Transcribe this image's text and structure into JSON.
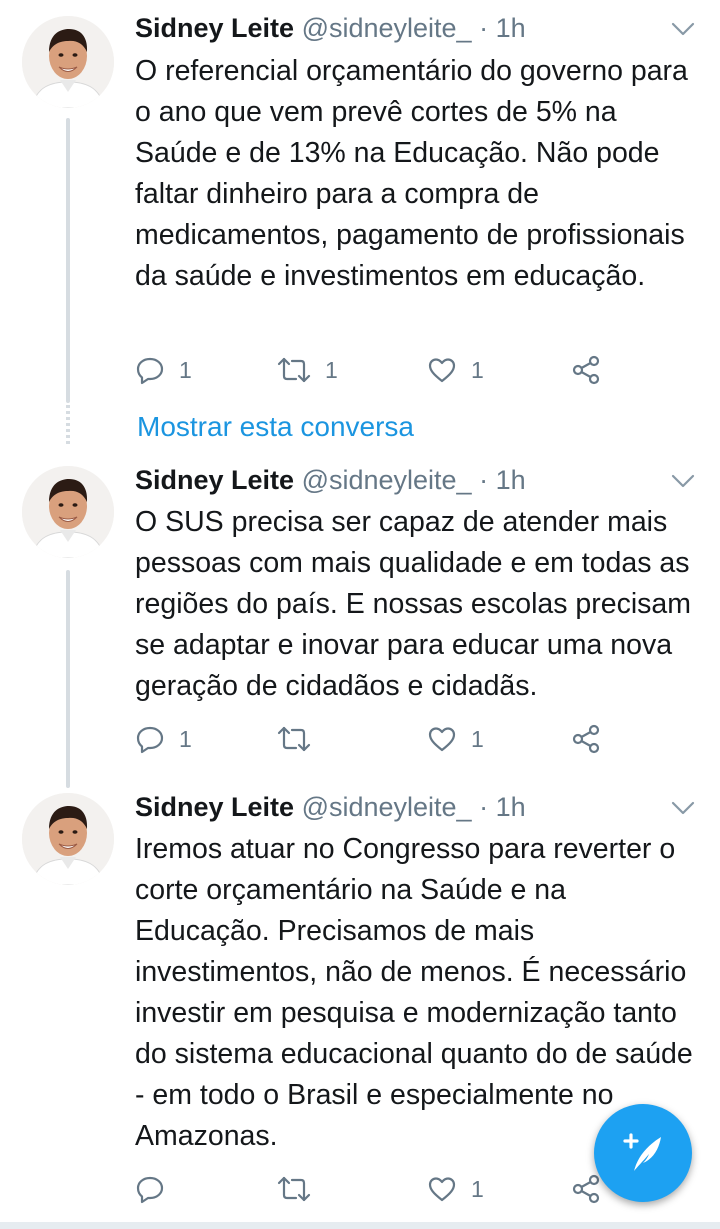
{
  "colors": {
    "accent": "#1da1f2",
    "link": "#1b95e0",
    "muted": "#657786",
    "text": "#14171a",
    "thread_line": "#d6dce1"
  },
  "show_conversation": "Mostrar esta conversa",
  "tweets": [
    {
      "name": "Sidney Leite",
      "handle": "@sidneyleite_",
      "separator": "·",
      "time": "1h",
      "text": "O referencial orçamentário do governo para o ano que vem prevê cortes de 5% na Saúde e de 13% na Educação. Não pode faltar dinheiro para a compra de medicamentos, pagamento de profissionais da saúde e investimentos em educação.",
      "replies": "1",
      "retweets": "1",
      "likes": "1"
    },
    {
      "name": "Sidney Leite",
      "handle": "@sidneyleite_",
      "separator": "·",
      "time": "1h",
      "text": "O SUS precisa ser capaz de atender mais pessoas com mais qualidade e em todas as regiões do país. E nossas escolas precisam se adaptar e inovar para educar uma nova geração de cidadãos e cidadãs.",
      "replies": "1",
      "retweets": "",
      "likes": "1"
    },
    {
      "name": "Sidney Leite",
      "handle": "@sidneyleite_",
      "separator": "·",
      "time": "1h",
      "text": "Iremos atuar no Congresso para reverter o corte orçamentário na Saúde e na Educação. Precisamos de mais investimentos, não de menos. É necessário investir em pesquisa e modernização tanto do sistema educacional quanto do de saúde - em todo o Brasil e especialmente no Amazonas.",
      "replies": "",
      "retweets": "",
      "likes": "1"
    }
  ],
  "icons": {
    "reply": "reply-icon",
    "retweet": "retweet-icon",
    "like": "heart-icon",
    "share": "share-icon",
    "caret": "chevron-down-icon",
    "compose": "compose-tweet-icon"
  }
}
